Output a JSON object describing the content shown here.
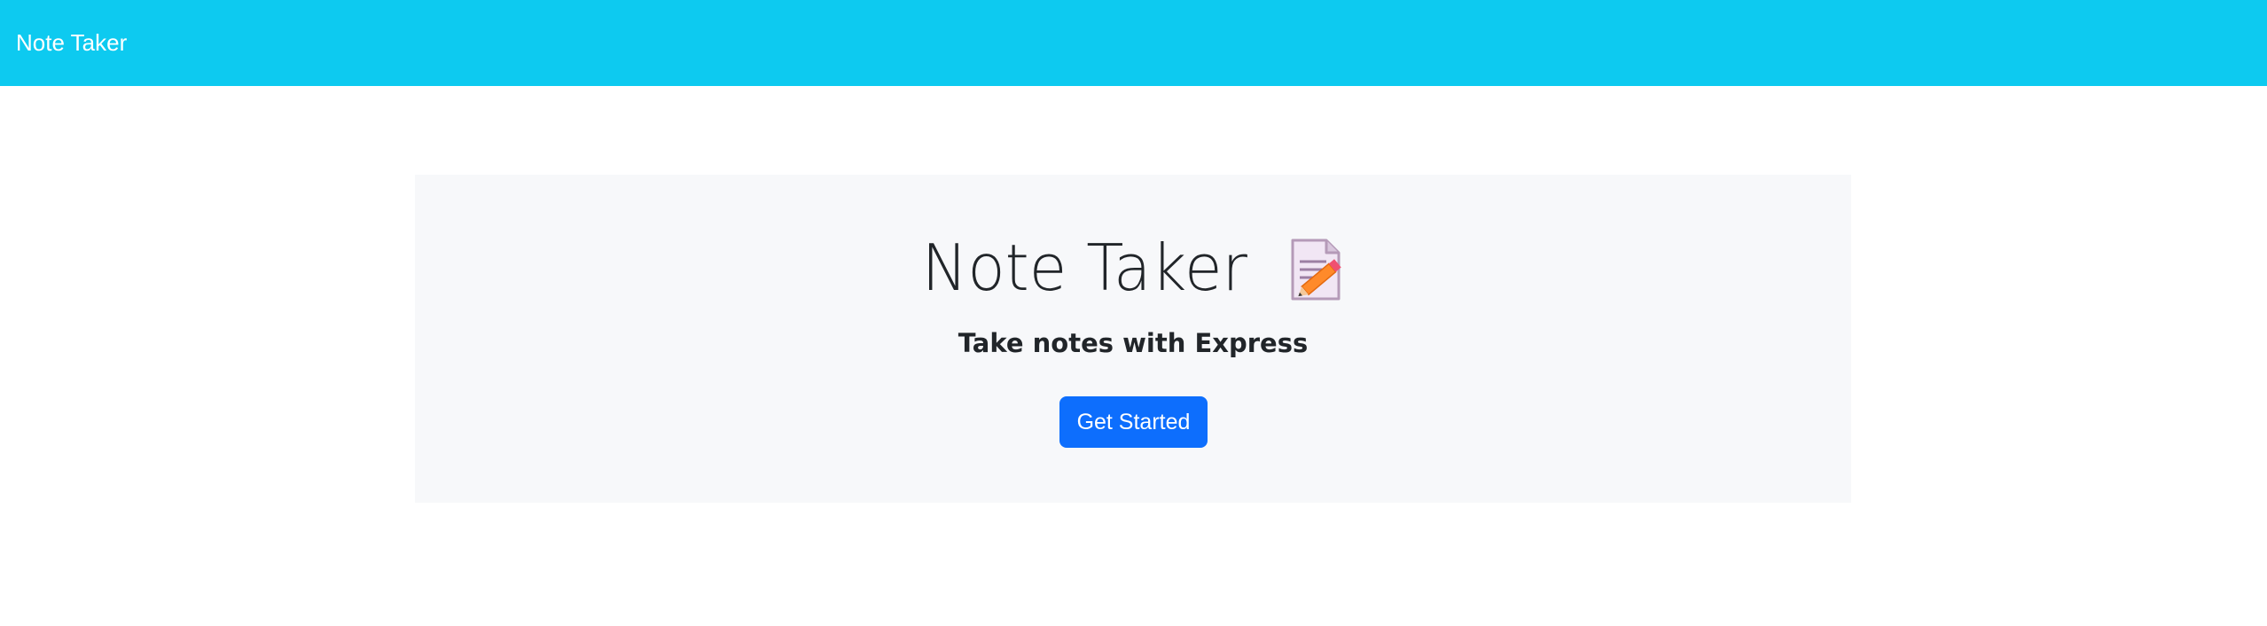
{
  "navbar": {
    "brand": "Note Taker",
    "background_color": "#0dcaf0"
  },
  "hero": {
    "title": "Note Taker",
    "title_icon": "memo-pencil-icon",
    "subtitle": "Take notes with Express",
    "cta_label": "Get Started",
    "cta_color": "#0d6efd",
    "panel_color": "#f7f8fa"
  }
}
